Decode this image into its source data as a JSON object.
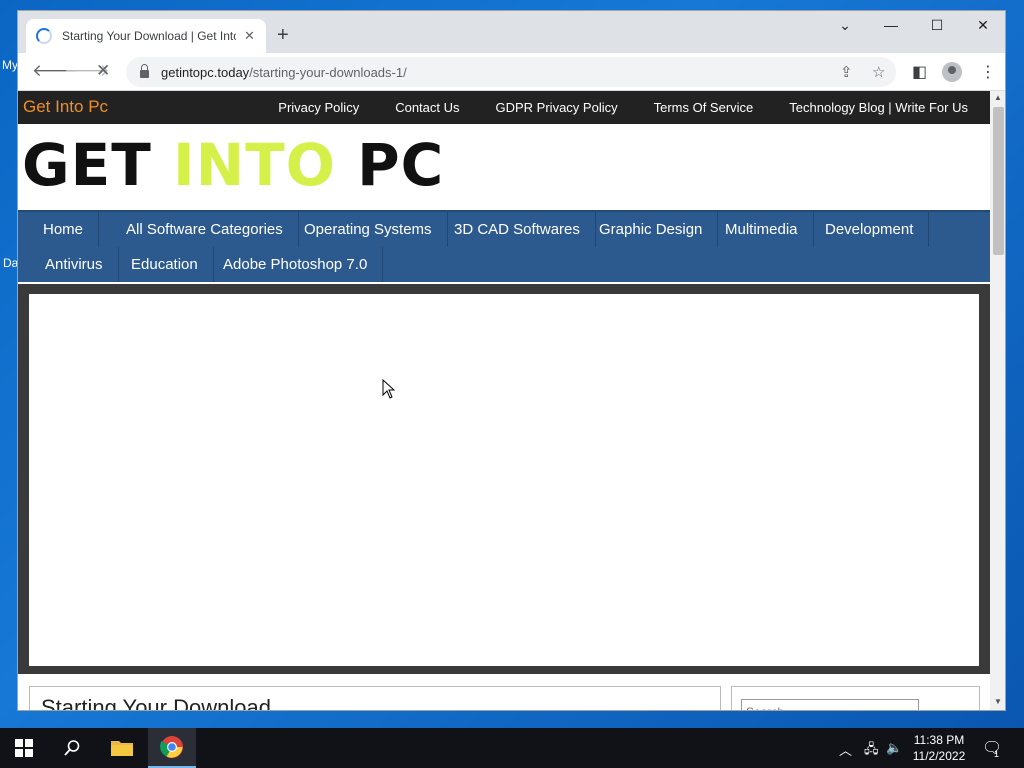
{
  "desktop": {
    "labels": [
      "My",
      "Da"
    ]
  },
  "browser": {
    "tab_title": "Starting Your Download | Get Into Pc",
    "tab_close": "✕",
    "new_tab": "+",
    "url_host": "getintopc.today",
    "url_path": "/starting-your-downloads-1/",
    "window_controls": {
      "tabs_menu": "⌄",
      "minimize": "—",
      "maximize": "☐",
      "close": "✕"
    }
  },
  "site": {
    "name": "Get Into Pc",
    "top_links": [
      "Privacy Policy",
      "Contact Us",
      "GDPR Privacy Policy",
      "Terms Of Service",
      "Technology Blog | Write For Us"
    ],
    "logo": {
      "part1": "GET ",
      "part2": "INTO",
      "part3": " PC"
    },
    "nav_row1": [
      "Home",
      "All Software Categories",
      "Operating Systems",
      "3D CAD Softwares",
      "Graphic Design",
      "Multimedia",
      "Development"
    ],
    "nav_row2": [
      "Antivirus",
      "Education",
      "Adobe Photoshop 7.0"
    ],
    "content_title": "Starting Your Download",
    "search_placeholder": "Search"
  },
  "taskbar": {
    "time": "11:38 PM",
    "date": "11/2/2022",
    "notification_count": "1"
  },
  "colors": {
    "site_name": "#ef8f22",
    "logo_green": "#d6f04a",
    "nav_bg": "#2d5a8e",
    "topbar_bg": "#222222"
  }
}
